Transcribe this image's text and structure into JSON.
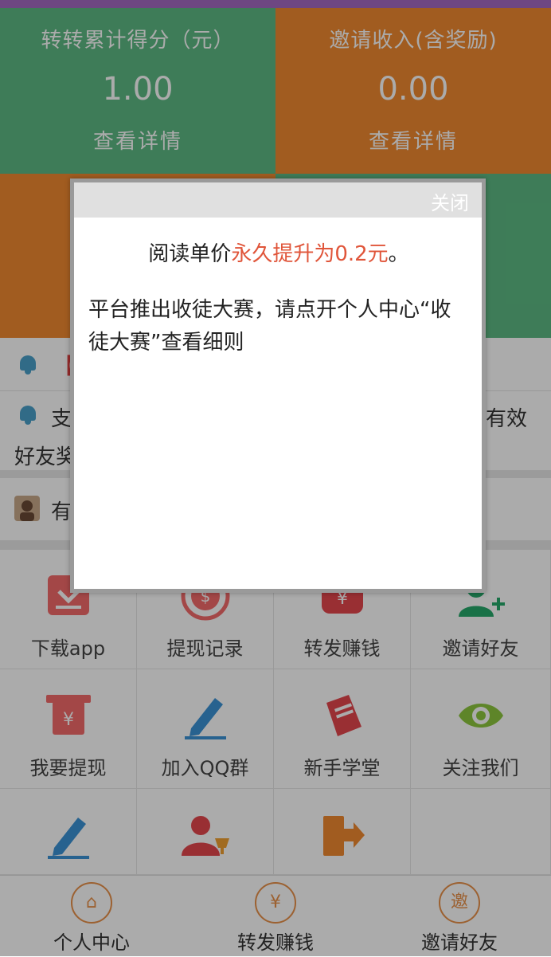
{
  "stats": {
    "score_title": "转转累计得分（元）",
    "score_value": "1.00",
    "score_link": "查看详情",
    "invite_title": "邀请收入(含奖励)",
    "invite_value": "0.00",
    "invite_link": "查看详情"
  },
  "notices": [
    {
      "icon": "bell-icon",
      "text": "【"
    },
    {
      "icon": "bell-icon",
      "text_left": "支",
      "text_right": "有效",
      "text_line2": "好友奖"
    },
    {
      "icon": "avatar-icon",
      "text": "有"
    }
  ],
  "grid": [
    {
      "label": "下载app",
      "icon": "download-icon",
      "color": "#f36b6b"
    },
    {
      "label": "提现记录",
      "icon": "coin-target-icon",
      "color": "#f36b6b"
    },
    {
      "label": "转发赚钱",
      "icon": "money-bag-icon",
      "color": "#e5474d"
    },
    {
      "label": "邀请好友",
      "icon": "add-user-icon",
      "color": "#26a96b"
    },
    {
      "label": "我要提现",
      "icon": "atm-withdraw-icon",
      "color": "#f36b6b"
    },
    {
      "label": "加入QQ群",
      "icon": "pen-icon",
      "color": "#3b92d6"
    },
    {
      "label": "新手学堂",
      "icon": "book-icon",
      "color": "#e5474d"
    },
    {
      "label": "关注我们",
      "icon": "eye-icon",
      "color": "#8cc63e"
    },
    {
      "label": "",
      "icon": "pen-icon",
      "color": "#3b92d6"
    },
    {
      "label": "",
      "icon": "user-trophy-icon",
      "color": "#e5474d"
    },
    {
      "label": "",
      "icon": "logout-icon",
      "color": "#f08a30"
    },
    {
      "label": "",
      "icon": "",
      "color": ""
    }
  ],
  "bottom_nav": [
    {
      "label": "个人中心",
      "icon": "home-icon",
      "glyph": "⌂"
    },
    {
      "label": "转发赚钱",
      "icon": "yen-icon",
      "glyph": "¥"
    },
    {
      "label": "邀请好友",
      "icon": "invite-icon",
      "glyph": "邀"
    }
  ],
  "modal": {
    "close_label": "关闭",
    "line1_prefix": "阅读单价",
    "line1_highlight": "永久提升为0.2元",
    "line1_suffix": "。",
    "line2": "平台推出收徒大赛，请点开个人中心“收徒大赛”查看细则"
  },
  "colors": {
    "green": "#5dba83",
    "orange": "#f08a30",
    "highlight": "#e0553a",
    "nav_accent": "#e9914a"
  }
}
